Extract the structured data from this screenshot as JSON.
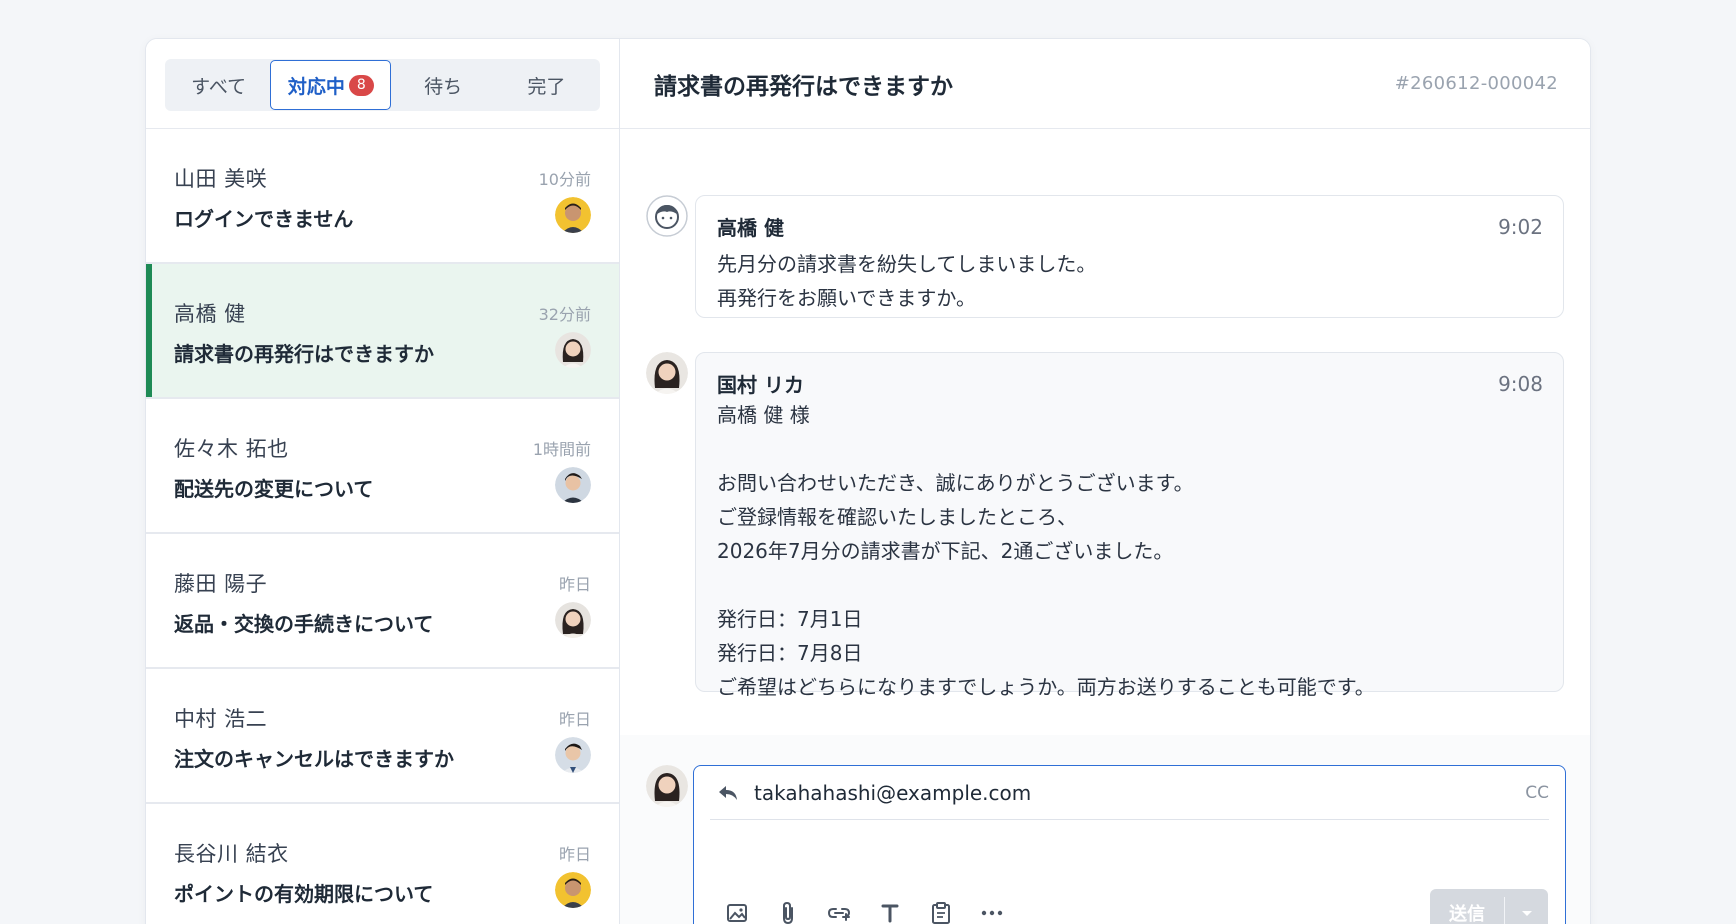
{
  "tabs": [
    {
      "label": "すべて"
    },
    {
      "label": "対応中",
      "badge": "8"
    },
    {
      "label": "待ち"
    },
    {
      "label": "完了"
    }
  ],
  "conversations": [
    {
      "name": "山田 美咲",
      "time": "10分前",
      "subject": "ログインできません"
    },
    {
      "name": "高橋 健",
      "time": "32分前",
      "subject": "請求書の再発行はできますか"
    },
    {
      "name": "佐々木 拓也",
      "time": "1時間前",
      "subject": "配送先の変更について"
    },
    {
      "name": "藤田 陽子",
      "time": "昨日",
      "subject": "返品・交換の手続きについて"
    },
    {
      "name": "中村 浩二",
      "time": "昨日",
      "subject": "注文のキャンセルはできますか"
    },
    {
      "name": "長谷川 結衣",
      "time": "昨日",
      "subject": "ポイントの有効期限について"
    }
  ],
  "header": {
    "title": "請求書の再発行はできますか",
    "ticket_id": "#260612-000042"
  },
  "messages": [
    {
      "sender": "高橋 健",
      "time": "9:02",
      "lines": [
        "先月分の請求書を紛失してしまいました。",
        "再発行をお願いできますか。"
      ]
    },
    {
      "sender": "国村 リカ",
      "time": "9:08",
      "lines": [
        "高橋 健 様",
        "",
        "お問い合わせいただき、誠にありがとうございます。",
        "ご登録情報を確認いたしましたところ、",
        "2026年7月分の請求書が下記、2通ございました。",
        "",
        "発行日：7月1日",
        "発行日：7月8日",
        "ご希望はどちらになりますでしょうか。両方お送りすることも可能です。"
      ]
    }
  ],
  "reply": {
    "to": "takahahashi@example.com",
    "cc": "CC",
    "send_label": "送信",
    "body": ""
  },
  "colors": {
    "accent": "#2f6fd6",
    "active_bar": "#1e8a55",
    "active_bg": "#eaf5ef",
    "badge": "#d94848"
  }
}
